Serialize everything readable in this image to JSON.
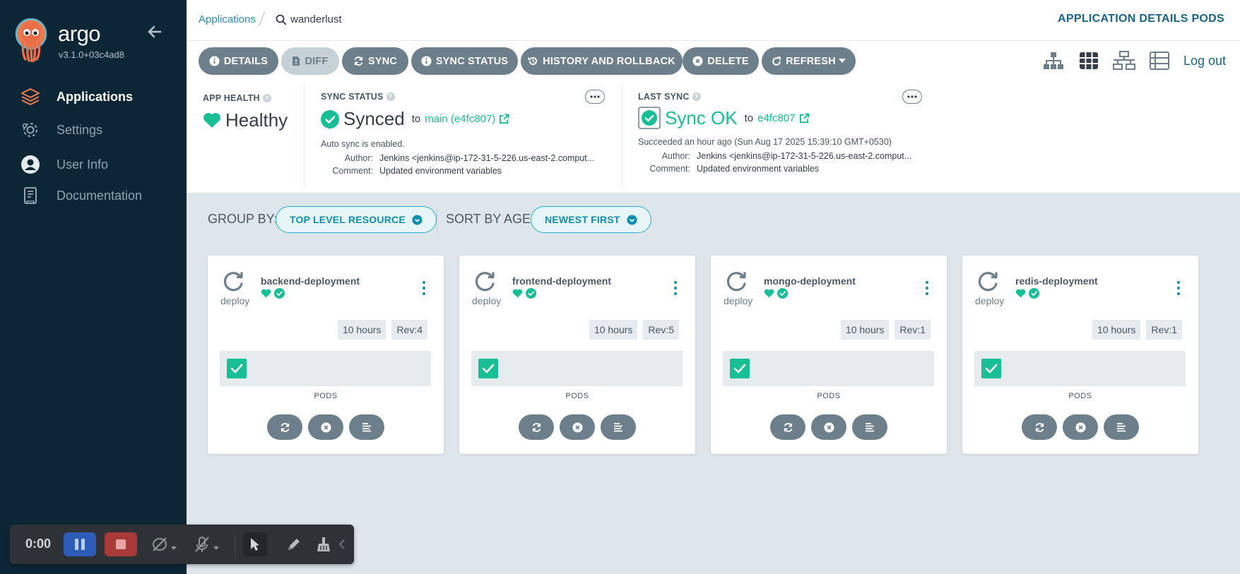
{
  "sidebar": {
    "brand": "argo",
    "version": "v3.1.0+03c4ad8",
    "items": [
      {
        "label": "Applications",
        "icon": "layers-icon",
        "active": true
      },
      {
        "label": "Settings",
        "icon": "gear-icon",
        "active": false
      },
      {
        "label": "User Info",
        "icon": "user-icon",
        "active": false
      },
      {
        "label": "Documentation",
        "icon": "book-icon",
        "active": false
      }
    ]
  },
  "topbar": {
    "breadcrumb_root": "Applications",
    "breadcrumb_current": "wanderlust",
    "page_title": "APPLICATION DETAILS PODS"
  },
  "actions": {
    "details": "DETAILS",
    "diff": "DIFF",
    "sync": "SYNC",
    "sync_status": "SYNC STATUS",
    "history": "HISTORY AND ROLLBACK",
    "delete": "DELETE",
    "refresh": "REFRESH",
    "logout": "Log out"
  },
  "app_health": {
    "title": "APP HEALTH",
    "value": "Healthy",
    "color": "#18be94"
  },
  "sync_status": {
    "title": "SYNC STATUS",
    "value": "Synced",
    "to": "to",
    "revision": "main (e4fc807)",
    "auto_sync": "Auto sync is enabled.",
    "author_label": "Author:",
    "author": "Jenkins <jenkins@ip-172-31-5-226.us-east-2.comput...",
    "comment_label": "Comment:",
    "comment": "Updated environment variables"
  },
  "last_sync": {
    "title": "LAST SYNC",
    "value": "Sync OK",
    "to": "to",
    "revision": "e4fc807",
    "succeeded": "Succeeded an hour ago (Sun Aug 17 2025 15:39:10 GMT+0530)",
    "author_label": "Author:",
    "author": "Jenkins <jenkins@ip-172-31-5-226.us-east-2.comput...",
    "comment_label": "Comment:",
    "comment": "Updated environment variables"
  },
  "filters": {
    "group_by_label": "GROUP BY:",
    "group_by_value": "TOP LEVEL RESOURCE",
    "sort_label": "SORT BY AGE:",
    "sort_value": "NEWEST FIRST"
  },
  "cards": [
    {
      "name": "backend-deployment",
      "kind": "deploy",
      "age": "10 hours",
      "rev": "Rev:4",
      "pods_label": "PODS"
    },
    {
      "name": "frontend-deployment",
      "kind": "deploy",
      "age": "10 hours",
      "rev": "Rev:5",
      "pods_label": "PODS"
    },
    {
      "name": "mongo-deployment",
      "kind": "deploy",
      "age": "10 hours",
      "rev": "Rev:1",
      "pods_label": "PODS"
    },
    {
      "name": "redis-deployment",
      "kind": "deploy",
      "age": "10 hours",
      "rev": "Rev:1",
      "pods_label": "PODS"
    }
  ],
  "recorder": {
    "time": "0:00"
  },
  "colors": {
    "sidebar_bg": "#0d2636",
    "accent_teal": "#18be94",
    "button_gray": "#6d7f8b",
    "link_blue": "#19648a",
    "content_bg": "#dee6eb"
  }
}
